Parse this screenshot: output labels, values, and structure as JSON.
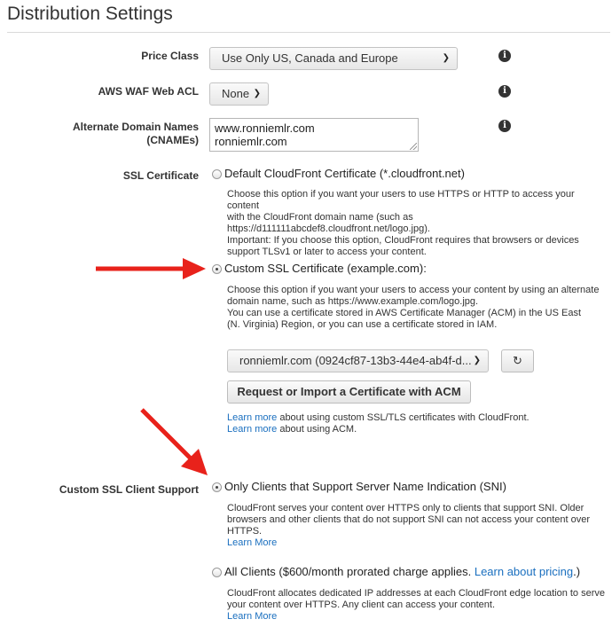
{
  "title": "Distribution Settings",
  "price_class": {
    "label": "Price Class",
    "value": "Use Only US, Canada and Europe"
  },
  "waf": {
    "label": "AWS WAF Web ACL",
    "value": "None"
  },
  "cnames": {
    "label_line1": "Alternate Domain Names",
    "label_line2": "(CNAMEs)",
    "line1": "www.ronniemlr.com",
    "line2": "ronniemlr.com"
  },
  "ssl": {
    "label": "SSL Certificate",
    "default_option": "Default CloudFront Certificate (*.cloudfront.net)",
    "default_desc": [
      "Choose this option if you want your users to use HTTPS or HTTP to access your content",
      "with the CloudFront domain name (such as",
      "https://d111111abcdef8.cloudfront.net/logo.jpg).",
      "Important: If you choose this option, CloudFront requires that browsers or devices",
      "support TLSv1 or later to access your content."
    ],
    "custom_option": "Custom SSL Certificate (example.com):",
    "custom_desc": [
      "Choose this option if you want your users to access your content by using an alternate",
      "domain name, such as https://www.example.com/logo.jpg.",
      "You can use a certificate stored in AWS Certificate Manager (ACM) in the US East",
      "(N. Virginia) Region, or you can use a certificate stored in IAM."
    ],
    "cert_value": "ronniemlr.com (0924cf87-13b3-44e4-ab4f-d...",
    "request_button": "Request or Import a Certificate with ACM",
    "learn_more_1": "Learn more",
    "learn_more_1_rest": " about using custom SSL/TLS certificates with CloudFront.",
    "learn_more_2": "Learn more",
    "learn_more_2_rest": " about using ACM."
  },
  "client_support": {
    "label": "Custom SSL Client Support",
    "sni_option": "Only Clients that Support Server Name Indication (SNI)",
    "sni_desc": [
      "CloudFront serves your content over HTTPS only to clients that support SNI. Older",
      "browsers and other clients that do not support SNI can not access your content over",
      "HTTPS."
    ],
    "sni_learn": "Learn More",
    "all_option": "All Clients ($600/month prorated charge applies.",
    "all_option_link": "Learn about pricing",
    "all_option_end": ".)",
    "all_desc": [
      "CloudFront allocates dedicated IP addresses at each CloudFront edge location to serve",
      "your content over HTTPS. Any client can access your content."
    ],
    "all_learn": "Learn More"
  },
  "colors": {
    "link": "#1a6fbf",
    "arrow": "#e8221b"
  }
}
